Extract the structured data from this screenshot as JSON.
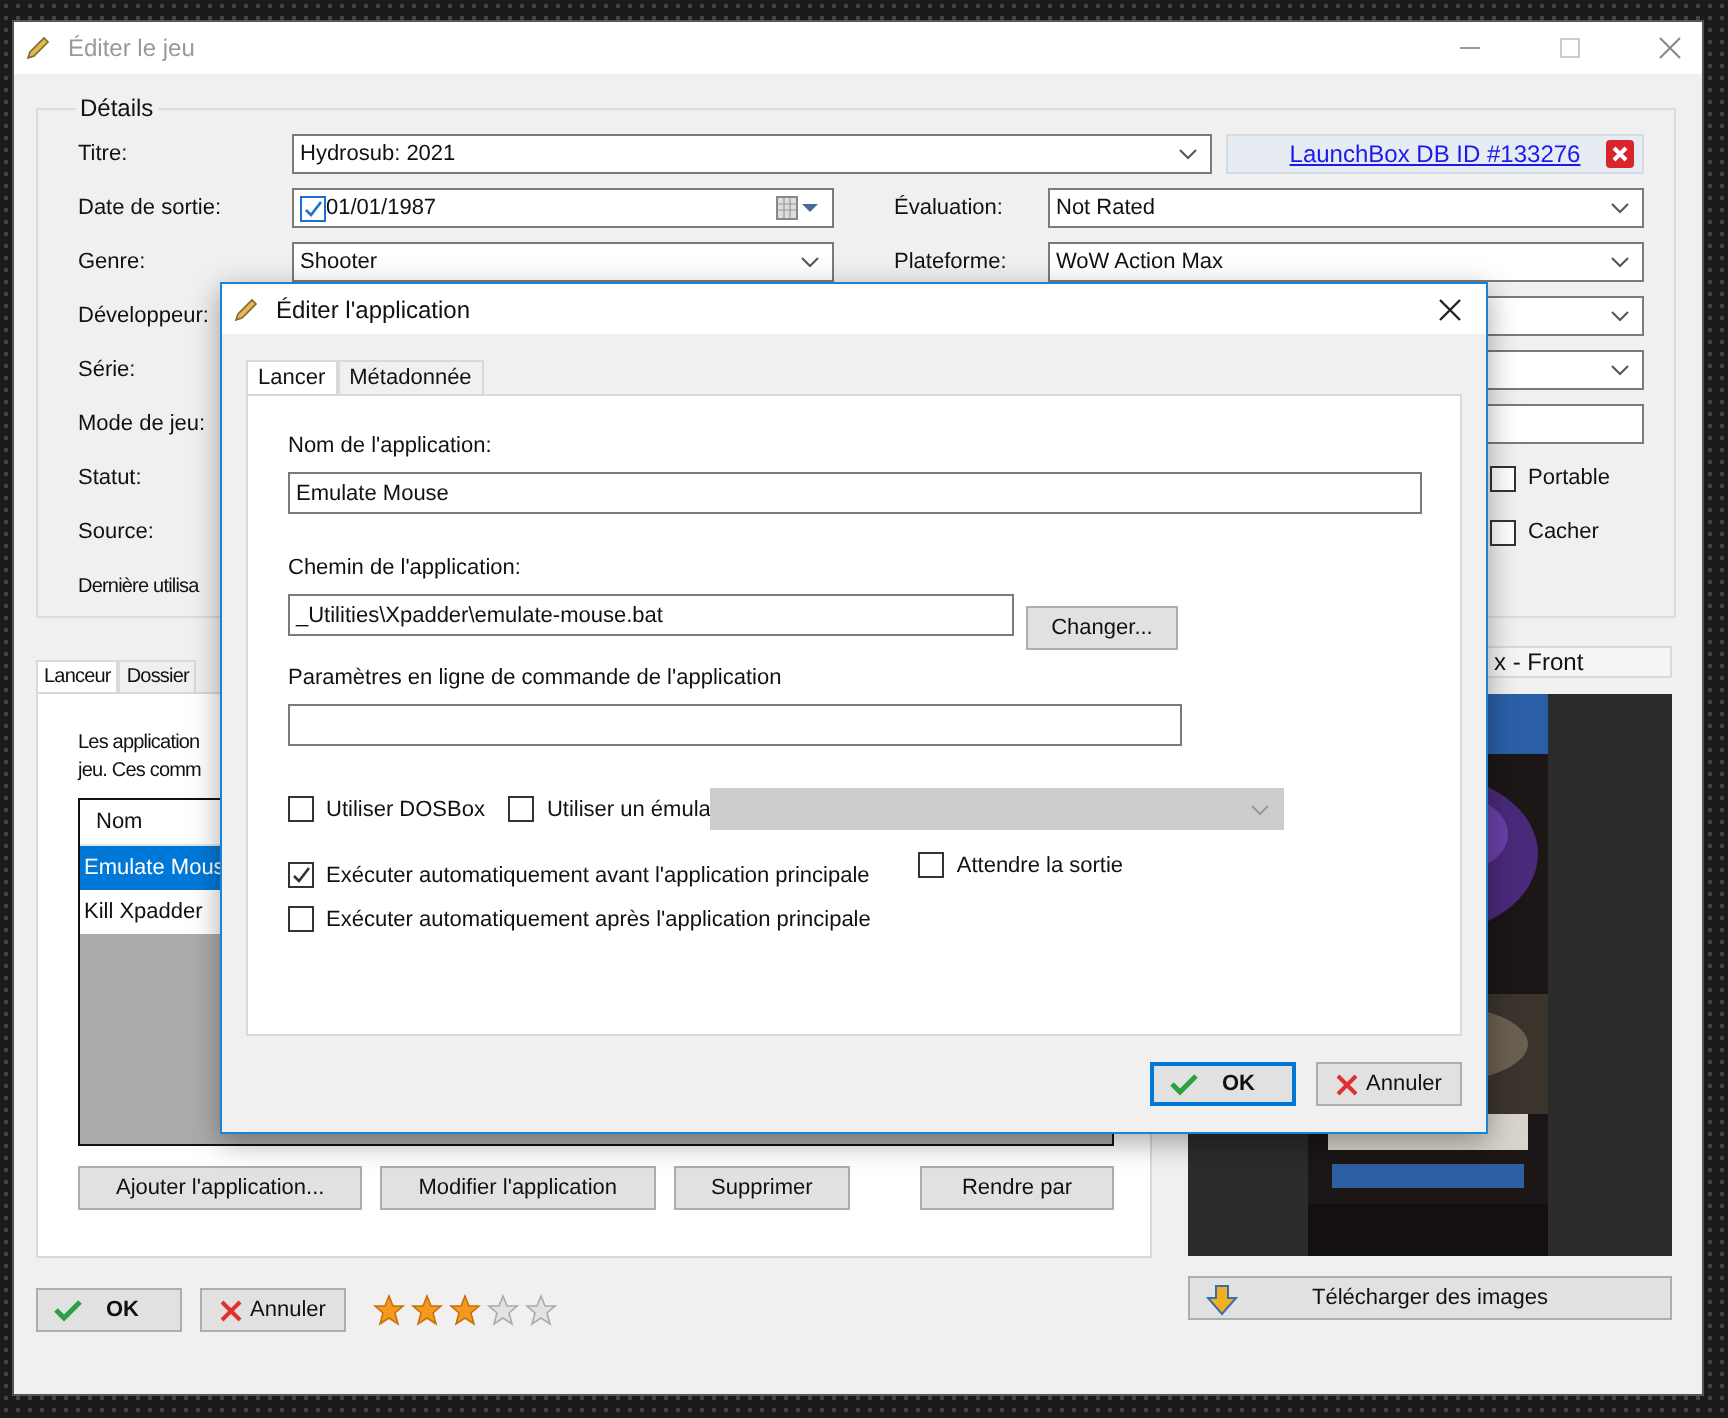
{
  "window": {
    "title": "Éditer le jeu"
  },
  "details": {
    "legend": "Détails",
    "left": [
      {
        "label": "Titre:",
        "kind": "combo",
        "value": "Hydrosub: 2021"
      },
      {
        "label": "Date de sortie:",
        "kind": "date",
        "value": "01/01/1987",
        "checked": true
      },
      {
        "label": "Genre:",
        "kind": "combo",
        "value": "Shooter"
      },
      {
        "label": "Développeur:"
      },
      {
        "label": "Série:"
      },
      {
        "label": "Mode de jeu:"
      },
      {
        "label": "Statut:"
      },
      {
        "label": "Source:"
      },
      {
        "label": "Dernière utilisa"
      }
    ],
    "database_link": "LaunchBox DB ID #133276",
    "right": [
      {
        "kind": "combo",
        "label": "Évaluation:",
        "value": "Not Rated"
      },
      {
        "kind": "combo",
        "label": "Plateforme:",
        "value": "WoW Action Max"
      },
      {
        "kind": "combo"
      },
      {
        "kind": "combo"
      },
      {
        "kind": "text"
      },
      {
        "kind": "checkbox",
        "label": "Portable",
        "checked": false
      },
      {
        "kind": "checkbox",
        "label": "Cacher",
        "checked": false
      }
    ]
  },
  "lower_tabs": [
    {
      "label": "Lanceur",
      "selected": true
    },
    {
      "label": "Dossier",
      "selected": false
    }
  ],
  "launcher": {
    "description": [
      "Les application",
      "jeu. Ces comm"
    ],
    "column": "Nom",
    "rows": [
      {
        "name": "Emulate Mous",
        "selected": true
      },
      {
        "name": "Kill Xpadder",
        "selected": false
      }
    ],
    "buttons": [
      "Ajouter l'application...",
      "Modifier l'application",
      "Supprimer"
    ],
    "render_button": "Rendre par"
  },
  "image_panel": {
    "header": "x - Front",
    "download_button": "Télécharger des images"
  },
  "footer": {
    "ok": "OK",
    "cancel": "Annuler",
    "stars": 3
  },
  "dialog": {
    "title": "Éditer l'application",
    "tabs": [
      {
        "label": "Lancer",
        "selected": true
      },
      {
        "label": "Métadonnée",
        "selected": false
      }
    ],
    "name_label": "Nom de l'application:",
    "name": "Emulate Mouse",
    "path_label": "Chemin de l'application:",
    "path": "_Utilities\\Xpadder\\emulate-mouse.bat",
    "change_button": "Changer...",
    "params_label": "Paramètres en ligne de commande de l'application",
    "options": [
      {
        "label": "Utiliser DOSBox",
        "checked": false
      },
      {
        "label": "Utiliser un émula",
        "checked": false
      }
    ],
    "emulator_disabled": true,
    "auto_run": [
      {
        "label": "Exécuter automatiquement avant l'application principale",
        "checked": true
      },
      {
        "label": "Exécuter automatiquement après l'application principale",
        "checked": false
      }
    ],
    "wait_exit": {
      "label": "Attendre la sortie",
      "checked": false
    },
    "ok": "OK",
    "cancel": "Annuler"
  }
}
